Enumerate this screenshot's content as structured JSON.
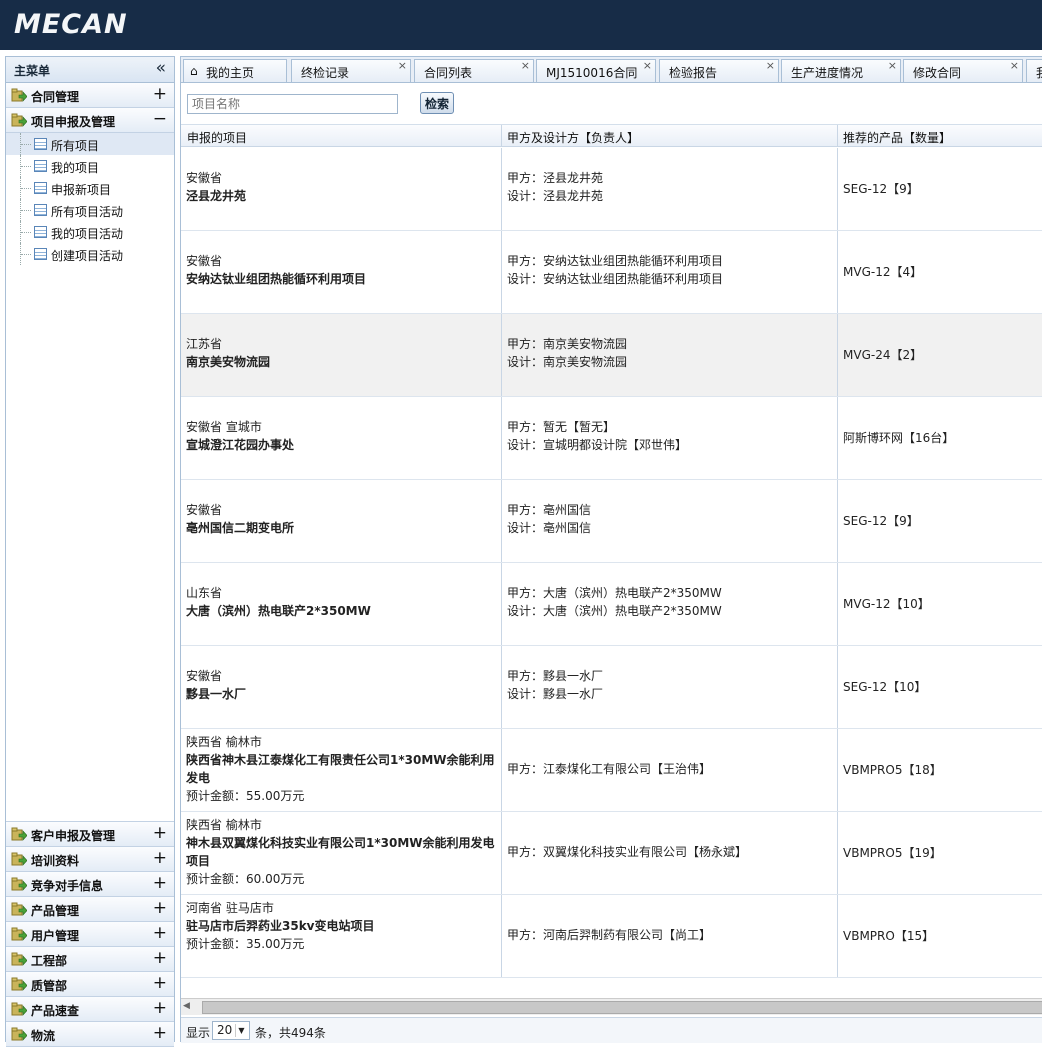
{
  "header": {
    "logo": "MECAN"
  },
  "sidebar": {
    "title": "主菜单",
    "collapse_icon": "«",
    "top_groups": [
      {
        "label": "合同管理",
        "toggle": "+"
      },
      {
        "label": "项目申报及管理",
        "toggle": "−"
      }
    ],
    "sub_items": [
      "所有项目",
      "我的项目",
      "申报新项目",
      "所有项目活动",
      "我的项目活动",
      "创建项目活动"
    ],
    "bottom_groups": [
      {
        "label": "客户申报及管理",
        "toggle": "+"
      },
      {
        "label": "培训资料",
        "toggle": "+"
      },
      {
        "label": "竞争对手信息",
        "toggle": "+"
      },
      {
        "label": "产品管理",
        "toggle": "+"
      },
      {
        "label": "用户管理",
        "toggle": "+"
      },
      {
        "label": "工程部",
        "toggle": "+"
      },
      {
        "label": "质管部",
        "toggle": "+"
      },
      {
        "label": "产品速查",
        "toggle": "+"
      },
      {
        "label": "物流",
        "toggle": "+"
      }
    ]
  },
  "tabs": [
    {
      "label": "我的主页",
      "home": true
    },
    {
      "label": "终检记录",
      "close": "×"
    },
    {
      "label": "合同列表",
      "close": "×"
    },
    {
      "label": "MJ1510016合同",
      "close": "×"
    },
    {
      "label": "检验报告",
      "close": "×"
    },
    {
      "label": "生产进度情况",
      "close": "×"
    },
    {
      "label": "修改合同",
      "close": "×"
    },
    {
      "label": "我"
    }
  ],
  "toolbar": {
    "search_placeholder": "项目名称",
    "search_button": "检索"
  },
  "grid": {
    "columns": [
      "申报的项目",
      "甲方及设计方【负责人】",
      "推荐的产品【数量】"
    ],
    "rows": [
      {
        "region": "安徽省",
        "name": "泾县龙井苑",
        "amount": "",
        "party": "甲方：泾县龙井苑",
        "design": "设计：泾县龙井苑",
        "product": "SEG-12【9】"
      },
      {
        "region": "安徽省",
        "name": "安纳达钛业组团热能循环利用项目",
        "amount": "",
        "party": "甲方：安纳达钛业组团热能循环利用项目",
        "design": "设计：安纳达钛业组团热能循环利用项目",
        "product": "MVG-12【4】"
      },
      {
        "region": "江苏省",
        "name": "南京美安物流园",
        "amount": "",
        "party": "甲方：南京美安物流园",
        "design": "设计：南京美安物流园",
        "product": "MVG-24【2】"
      },
      {
        "region": "安徽省 宣城市",
        "name": "宣城澄江花园办事处",
        "amount": "",
        "party": "甲方：暂无【暂无】",
        "design": "设计：宣城明都设计院【邓世伟】",
        "product": "阿斯博环网【16台】"
      },
      {
        "region": "安徽省",
        "name": "亳州国信二期变电所",
        "amount": "",
        "party": "甲方：亳州国信",
        "design": "设计：亳州国信",
        "product": "SEG-12【9】"
      },
      {
        "region": "山东省",
        "name": "大唐（滨州）热电联产2*350MW",
        "amount": "",
        "party": "甲方：大唐（滨州）热电联产2*350MW",
        "design": "设计：大唐（滨州）热电联产2*350MW",
        "product": "MVG-12【10】"
      },
      {
        "region": "安徽省",
        "name": "黟县一水厂",
        "amount": "",
        "party": "甲方：黟县一水厂",
        "design": "设计：黟县一水厂",
        "product": "SEG-12【10】"
      },
      {
        "region": "陕西省 榆林市",
        "name": "陕西省神木县江泰煤化工有限责任公司1*30MW余能利用发电",
        "amount": "预计金额：55.00万元",
        "party": "甲方：江泰煤化工有限公司【王治伟】",
        "design": "",
        "product": "VBMPRO5【18】"
      },
      {
        "region": "陕西省 榆林市",
        "name": "神木县双翼煤化科技实业有限公司1*30MW余能利用发电项目",
        "amount": "预计金额：60.00万元",
        "party": "甲方：双翼煤化科技实业有限公司【杨永斌】",
        "design": "",
        "product": "VBMPRO5【19】"
      },
      {
        "region": "河南省 驻马店市",
        "name": "驻马店市后羿药业35kv变电站项目",
        "amount": "预计金额：35.00万元",
        "party": "甲方：河南后羿制药有限公司【尚工】",
        "design": "",
        "product": "VBMPRO【15】"
      }
    ]
  },
  "pager": {
    "prefix": "显示",
    "page_size": "20",
    "suffix": "条，共494条"
  },
  "colors": {
    "topbar": "#172c47",
    "border": "#a9bfd6",
    "alt_row": "#f1f1f1"
  }
}
